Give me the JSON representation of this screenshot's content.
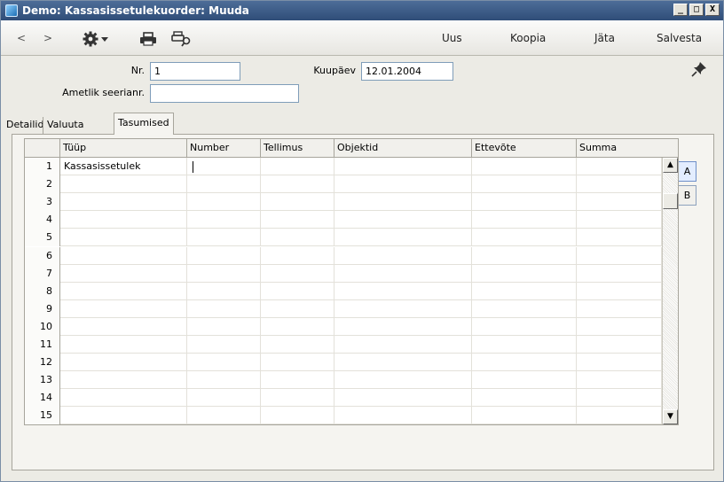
{
  "window": {
    "title": "Demo: Kassasissetulekuorder: Muuda",
    "controls": [
      "_",
      "□",
      "X"
    ]
  },
  "toolbar": {
    "back_label": "<",
    "forward_label": ">",
    "settings_icon": "gear-icon",
    "print_icon": "printer-icon",
    "print_preview_icon": "print-preview-icon",
    "new_label": "Uus",
    "copy_label": "Koopia",
    "leave_label": "Jäta",
    "save_label": "Salvesta"
  },
  "header": {
    "nr_label": "Nr.",
    "nr_value": "1",
    "date_label": "Kuupäev",
    "date_value": "12.01.2004",
    "official_serial_label": "Ametlik seerianr.",
    "official_serial_value": ""
  },
  "tabs": [
    {
      "label": "Detailid"
    },
    {
      "label": "Valuuta"
    },
    {
      "label": "Tasumised"
    }
  ],
  "side_tabs": [
    "A",
    "B"
  ],
  "grid": {
    "columns": [
      "Tüüp",
      "Number",
      "Tellimus",
      "Objektid",
      "Ettevõte",
      "Summa"
    ],
    "rows": [
      {
        "n": "1",
        "cells": [
          "Kassasissetulek",
          "",
          "",
          "",
          "",
          ""
        ]
      },
      {
        "n": "2",
        "cells": [
          "",
          "",
          "",
          "",
          "",
          ""
        ]
      },
      {
        "n": "3",
        "cells": [
          "",
          "",
          "",
          "",
          "",
          ""
        ]
      },
      {
        "n": "4",
        "cells": [
          "",
          "",
          "",
          "",
          "",
          ""
        ]
      },
      {
        "n": "5",
        "cells": [
          "",
          "",
          "",
          "",
          "",
          ""
        ]
      },
      {
        "n": "6",
        "cells": [
          "",
          "",
          "",
          "",
          "",
          ""
        ]
      },
      {
        "n": "7",
        "cells": [
          "",
          "",
          "",
          "",
          "",
          ""
        ]
      },
      {
        "n": "8",
        "cells": [
          "",
          "",
          "",
          "",
          "",
          ""
        ]
      },
      {
        "n": "9",
        "cells": [
          "",
          "",
          "",
          "",
          "",
          ""
        ]
      },
      {
        "n": "10",
        "cells": [
          "",
          "",
          "",
          "",
          "",
          ""
        ]
      },
      {
        "n": "11",
        "cells": [
          "",
          "",
          "",
          "",
          "",
          ""
        ]
      },
      {
        "n": "12",
        "cells": [
          "",
          "",
          "",
          "",
          "",
          ""
        ]
      },
      {
        "n": "13",
        "cells": [
          "",
          "",
          "",
          "",
          "",
          ""
        ]
      },
      {
        "n": "14",
        "cells": [
          "",
          "",
          "",
          "",
          "",
          ""
        ]
      },
      {
        "n": "15",
        "cells": [
          "",
          "",
          "",
          "",
          "",
          ""
        ]
      }
    ]
  }
}
